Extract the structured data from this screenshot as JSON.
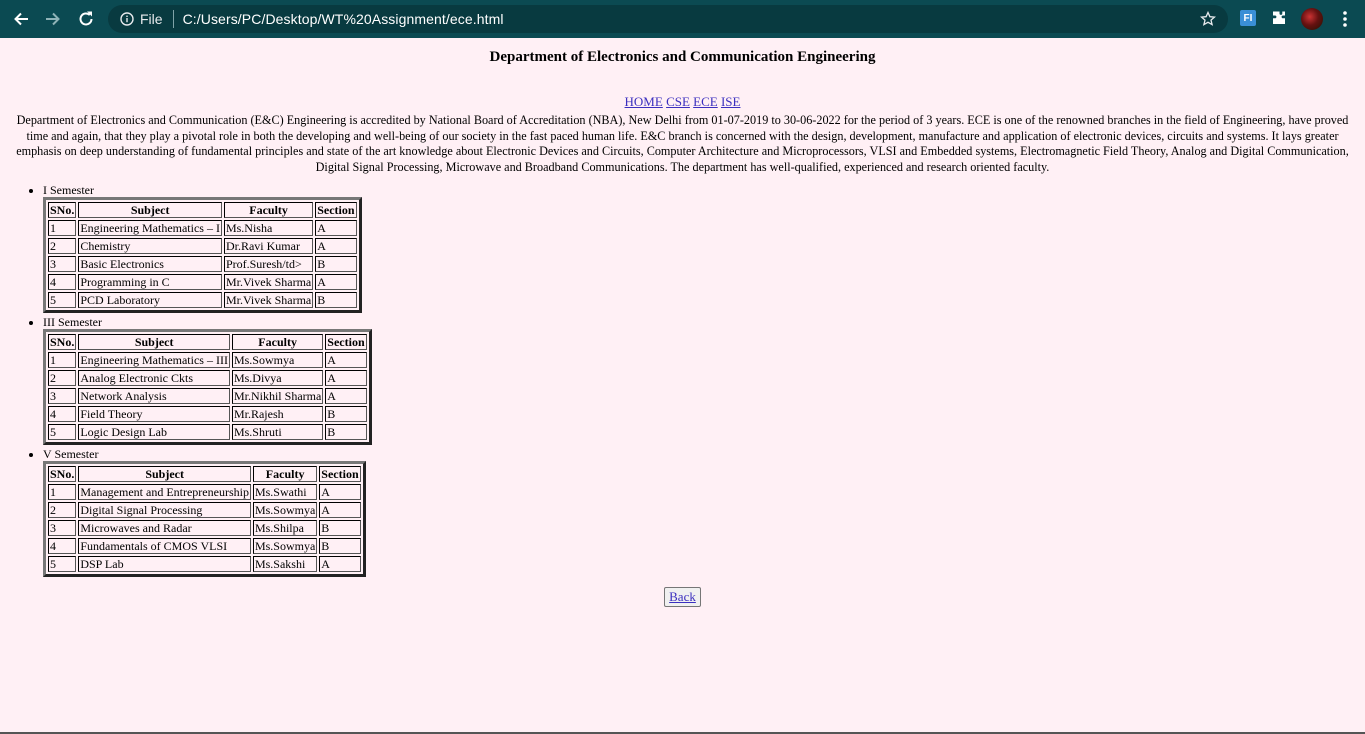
{
  "browser": {
    "scheme": "File",
    "url": "C:/Users/PC/Desktop/WT%20Assignment/ece.html",
    "extension_badge": "FI"
  },
  "page": {
    "heading": "Department of Electronics and Communication Engineering",
    "nav": [
      "HOME",
      "CSE",
      "ECE",
      "ISE"
    ],
    "intro": "Department of Electronics and Communication (E&C) Engineering is accredited by National Board of Accreditation (NBA), New Delhi from 01-07-2019 to 30-06-2022 for the period of 3 years. ECE is one of the renowned branches in the field of Engineering, have proved time and again, that they play a pivotal role in both the developing and well-being of our society in the fast paced human life. E&C branch is concerned with the design, development, manufacture and application of electronic devices, circuits and systems. It lays greater emphasis on deep understanding of fundamental principles and state of the art knowledge about Electronic Devices and Circuits, Computer Architecture and Microprocessors, VLSI and Embedded systems, Electromagnetic Field Theory, Analog and Digital Communication, Digital Signal Processing, Microwave and Broadband Communications. The department has well-qualified, experienced and research oriented faculty.",
    "table_headers": [
      "SNo.",
      "Subject",
      "Faculty",
      "Section"
    ],
    "semesters": [
      {
        "title": "I Semester",
        "rows": [
          [
            "1",
            "Engineering Mathematics – I",
            "Ms.Nisha",
            "A"
          ],
          [
            "2",
            "Chemistry",
            "Dr.Ravi Kumar",
            "A"
          ],
          [
            "3",
            "Basic Electronics",
            "Prof.Suresh/td>",
            "B"
          ],
          [
            "4",
            "Programming in C",
            "Mr.Vivek Sharma",
            "A"
          ],
          [
            "5",
            "PCD Laboratory",
            "Mr.Vivek Sharma",
            "B"
          ]
        ]
      },
      {
        "title": "III Semester",
        "rows": [
          [
            "1",
            "Engineering Mathematics – III",
            "Ms.Sowmya",
            "A"
          ],
          [
            "2",
            "Analog Electronic Ckts",
            "Ms.Divya",
            "A"
          ],
          [
            "3",
            "Network Analysis",
            "Mr.Nikhil Sharma",
            "A"
          ],
          [
            "4",
            "Field Theory",
            "Mr.Rajesh",
            "B"
          ],
          [
            "5",
            "Logic Design Lab",
            "Ms.Shruti",
            "B"
          ]
        ]
      },
      {
        "title": "V Semester",
        "rows": [
          [
            "1",
            "Management and Entrepreneurship",
            "Ms.Swathi",
            "A"
          ],
          [
            "2",
            "Digital Signal Processing",
            "Ms.Sowmya",
            "A"
          ],
          [
            "3",
            "Microwaves and Radar",
            "Ms.Shilpa",
            "B"
          ],
          [
            "4",
            "Fundamentals of CMOS VLSI",
            "Ms.Sowmya",
            "B"
          ],
          [
            "5",
            "DSP Lab",
            "Ms.Sakshi",
            "A"
          ]
        ]
      }
    ],
    "back_label": "Back"
  }
}
